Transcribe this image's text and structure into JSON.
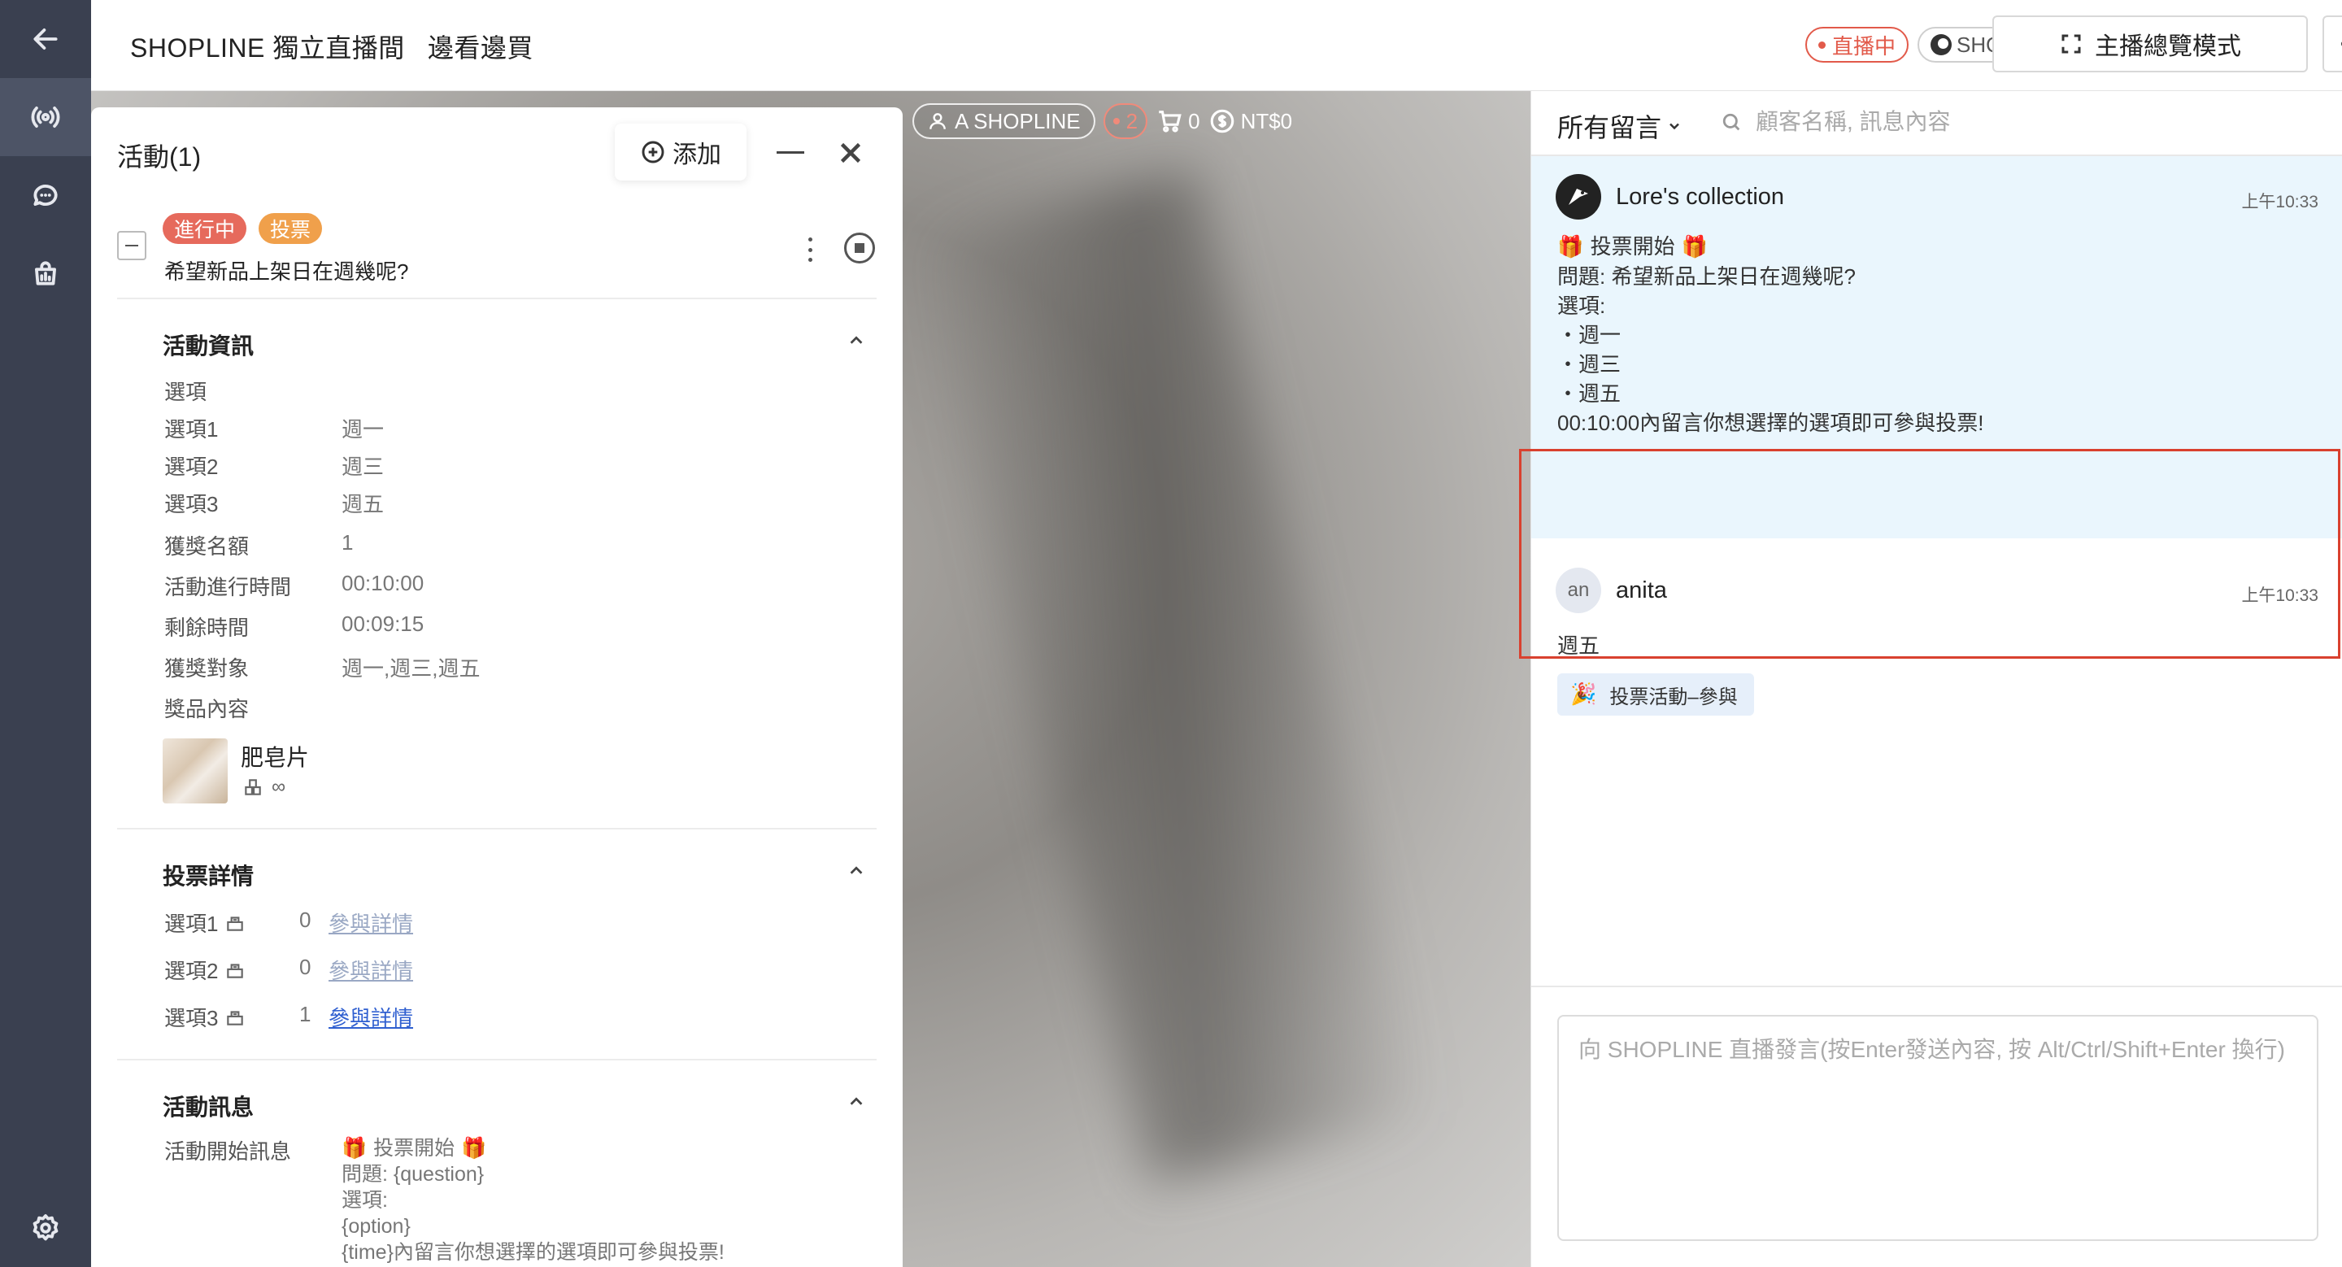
{
  "header": {
    "title": "SHOPLINE 獨立直播間   邊看邊買",
    "live_badge": "直播中",
    "brand_badge": "SHOPLINE",
    "host_mode_button": "主播總覽模式"
  },
  "video_stats": {
    "account": "A SHOPLINE",
    "viewers": "2",
    "cart": "0",
    "revenue": "NT$0"
  },
  "activity": {
    "title": "活動(1)",
    "add_label": "添加",
    "tags": {
      "status": "進行中",
      "type": "投票"
    },
    "question": "希望新品上架日在週幾呢?",
    "info": {
      "title": "活動資訊",
      "options_header": "選項",
      "rows": [
        {
          "label": "選項1",
          "value": "週一"
        },
        {
          "label": "選項2",
          "value": "週三"
        },
        {
          "label": "選項3",
          "value": "週五"
        },
        {
          "label": "獲獎名額",
          "value": "1"
        },
        {
          "label": "活動進行時間",
          "value": "00:10:00"
        },
        {
          "label": "剩餘時間",
          "value": "00:09:15"
        },
        {
          "label": "獲獎對象",
          "value": "週一,週三,週五"
        }
      ],
      "prize_header": "獎品內容",
      "prize_name": "肥皂片",
      "prize_qty": "∞"
    },
    "votes": {
      "title": "投票詳情",
      "rows": [
        {
          "label": "選項1",
          "count": "0",
          "link": "參與詳情"
        },
        {
          "label": "選項2",
          "count": "0",
          "link": "參與詳情"
        },
        {
          "label": "選項3",
          "count": "1",
          "link": "參與詳情"
        }
      ]
    },
    "message": {
      "title": "活動訊息",
      "label": "活動開始訊息",
      "lines": [
        "🎁 投票開始 🎁",
        "問題: {question}",
        "選項:",
        "{option}",
        "{time}內留言你想選擇的選項即可參與投票!"
      ]
    }
  },
  "chat": {
    "filter_label": "所有留言",
    "search_placeholder": "顧客名稱, 訊息內容",
    "host_message": {
      "name": "Lore's collection",
      "time": "上午10:33",
      "lines": [
        "🎁 投票開始 🎁",
        "問題: 希望新品上架日在週幾呢?",
        "選項:",
        "・週一",
        "・週三",
        "・週五",
        "00:10:00內留言你想選擇的選項即可參與投票!"
      ]
    },
    "user_message": {
      "avatar_initials": "an",
      "name": "anita",
      "time": "上午10:33",
      "text": "週五",
      "tag_icon": "🎉",
      "tag_label": "投票活動–參與"
    },
    "compose_placeholder": "向 SHOPLINE 直播發言(按Enter發送內容, 按 Alt/Ctrl/Shift+Enter 換行)"
  },
  "colors": {
    "rail": "#3a4050",
    "live_red": "#e25a4a",
    "tag_ongoing": "#e66a5c",
    "tag_vote": "#f0a04b",
    "host_msg_bg": "#eaf6fd",
    "link_blue": "#2f5fd0",
    "highlight_border": "#d9412f"
  }
}
